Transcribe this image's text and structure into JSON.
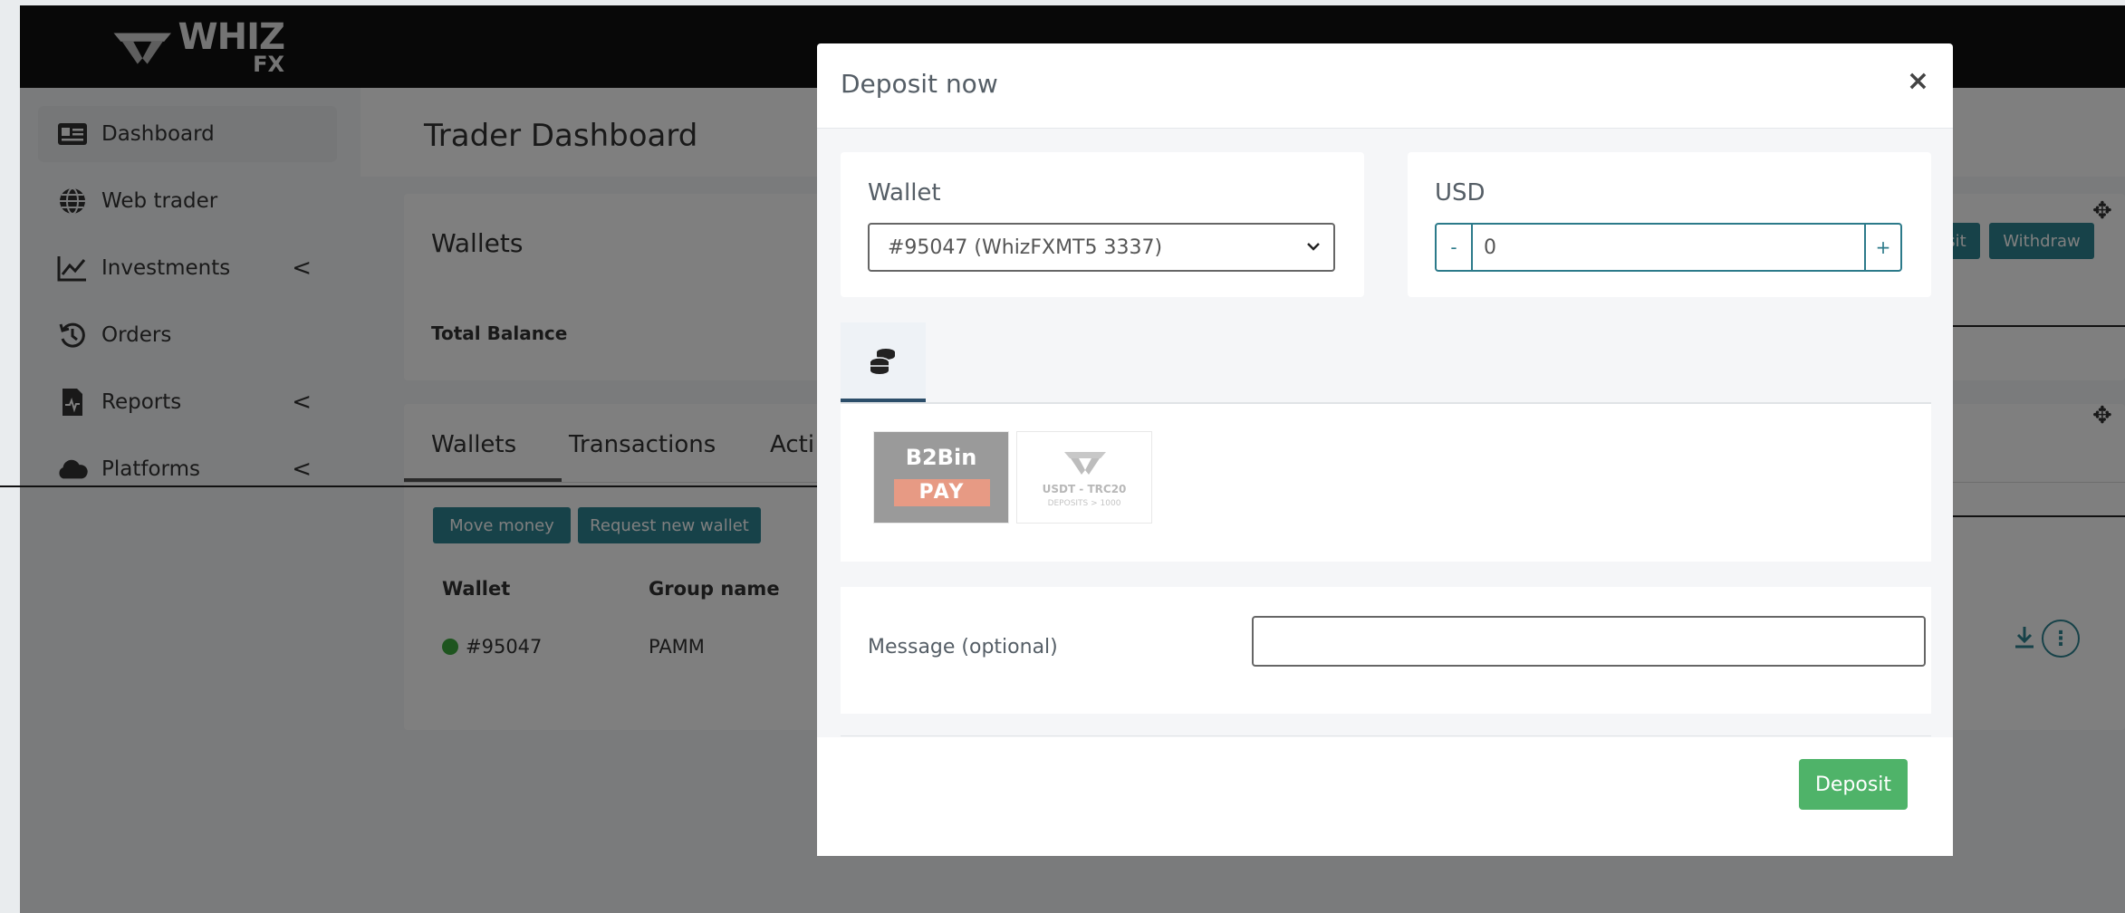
{
  "brand": {
    "name": "WHIZ",
    "sub": "FX"
  },
  "sidebar": {
    "items": [
      {
        "label": "Dashboard",
        "icon": "id-card-icon",
        "active": true
      },
      {
        "label": "Web trader",
        "icon": "globe-icon"
      },
      {
        "label": "Investments",
        "icon": "chart-line-icon",
        "has_submenu": true
      },
      {
        "label": "Orders",
        "icon": "history-icon"
      },
      {
        "label": "Reports",
        "icon": "file-report-icon",
        "has_submenu": true
      },
      {
        "label": "Platforms",
        "icon": "cloud-icon",
        "has_submenu": true
      }
    ],
    "chevron": "<"
  },
  "page": {
    "title": "Trader Dashboard",
    "wallets_card": {
      "title": "Wallets",
      "total_balance_label": "Total Balance",
      "buttons": {
        "deposit": "sit",
        "withdraw": "Withdraw"
      }
    },
    "tabs": [
      "Wallets",
      "Transactions",
      "Acti"
    ],
    "actions": {
      "move_money": "Move money",
      "request_new_wallet": "Request new wallet"
    },
    "table": {
      "headers": [
        "Wallet",
        "Group name"
      ],
      "rows": [
        {
          "wallet": "#95047",
          "group": "PAMM"
        }
      ]
    }
  },
  "modal": {
    "title": "Deposit now",
    "close": "×",
    "wallet_label": "Wallet",
    "wallet_selected": "#95047 (WhizFXMT5 3337)",
    "currency_label": "USD",
    "amount_value": "0",
    "minus": "-",
    "plus": "+",
    "payment_methods": [
      {
        "name": "B2BinPay",
        "logo_text_top": "B2Bin",
        "logo_text_bottom": "PAY"
      },
      {
        "name": "USDT - TRC20",
        "logo_text_top": "USDT - TRC20",
        "logo_text_bottom": "DEPOSITS > 1000"
      }
    ],
    "message_label": "Message (optional)",
    "message_value": "",
    "submit_label": "Deposit"
  },
  "colors": {
    "accent_teal": "#2f8592",
    "deposit_green": "#4fb369",
    "status_green": "#3cab3e"
  }
}
